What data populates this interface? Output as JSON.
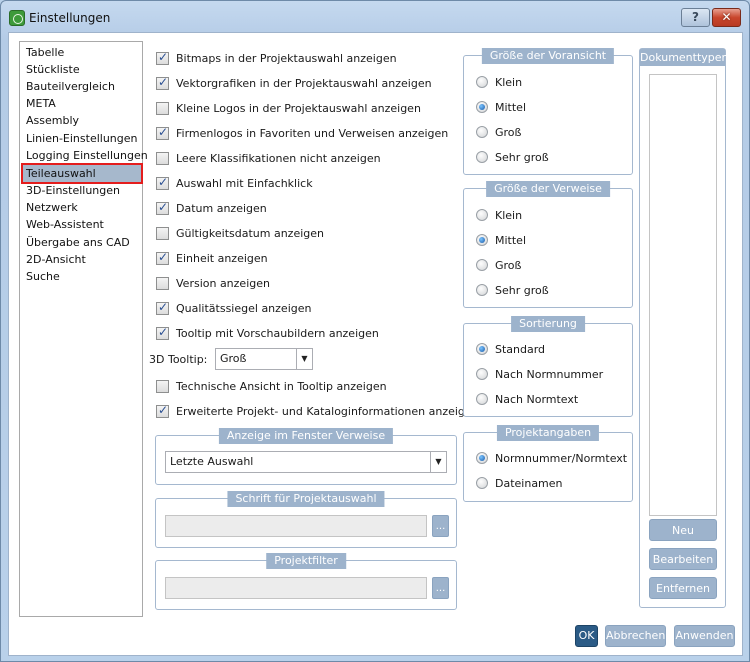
{
  "window": {
    "title": "Einstellungen",
    "help_label": "?",
    "close_label": "✕"
  },
  "nav": {
    "items": [
      {
        "label": "Tabelle"
      },
      {
        "label": "Stückliste"
      },
      {
        "label": "Bauteilvergleich"
      },
      {
        "label": "META"
      },
      {
        "label": "Assembly"
      },
      {
        "label": "Linien-Einstellungen"
      },
      {
        "label": "Logging Einstellungen"
      },
      {
        "label": "Teileauswahl",
        "selected": true
      },
      {
        "label": "3D-Einstellungen"
      },
      {
        "label": "Netzwerk"
      },
      {
        "label": "Web-Assistent"
      },
      {
        "label": "Übergabe ans CAD"
      },
      {
        "label": "2D-Ansicht"
      },
      {
        "label": "Suche"
      }
    ]
  },
  "options": {
    "checkboxes": [
      {
        "label": "Bitmaps in der Projektauswahl anzeigen",
        "checked": true
      },
      {
        "label": "Vektorgrafiken in der Projektauswahl anzeigen",
        "checked": true
      },
      {
        "label": "Kleine Logos in der Projektauswahl anzeigen",
        "checked": false
      },
      {
        "label": "Firmenlogos in Favoriten und Verweisen anzeigen",
        "checked": true
      },
      {
        "label": "Leere Klassifikationen nicht anzeigen",
        "checked": false
      },
      {
        "label": "Auswahl mit Einfachklick",
        "checked": true
      },
      {
        "label": "Datum anzeigen",
        "checked": true
      },
      {
        "label": "Gültigkeitsdatum anzeigen",
        "checked": false
      },
      {
        "label": "Einheit anzeigen",
        "checked": true
      },
      {
        "label": "Version anzeigen",
        "checked": false
      },
      {
        "label": "Qualitätssiegel anzeigen",
        "checked": true
      },
      {
        "label": "Tooltip mit Vorschaubildern anzeigen",
        "checked": true
      }
    ],
    "tooltip_3d": {
      "label": "3D Tooltip:",
      "value": "Groß"
    },
    "checkboxes_after": [
      {
        "label": "Technische Ansicht in Tooltip anzeigen",
        "checked": false
      },
      {
        "label": "Erweiterte Projekt- und Kataloginformationen anzeigen",
        "checked": true
      }
    ]
  },
  "groups": {
    "anzeige_verweise": {
      "title": "Anzeige im Fenster Verweise",
      "value": "Letzte Auswahl"
    },
    "schrift": {
      "title": "Schrift für Projektauswahl",
      "value": "",
      "button": "..."
    },
    "projektfilter": {
      "title": "Projektfilter",
      "value": "",
      "button": "..."
    },
    "voransicht": {
      "title": "Größe der Voransicht",
      "options": [
        {
          "label": "Klein",
          "checked": false
        },
        {
          "label": "Mittel",
          "checked": true
        },
        {
          "label": "Groß",
          "checked": false
        },
        {
          "label": "Sehr groß",
          "checked": false
        }
      ]
    },
    "verweise": {
      "title": "Größe der Verweise",
      "options": [
        {
          "label": "Klein",
          "checked": false
        },
        {
          "label": "Mittel",
          "checked": true
        },
        {
          "label": "Groß",
          "checked": false
        },
        {
          "label": "Sehr groß",
          "checked": false
        }
      ]
    },
    "sortierung": {
      "title": "Sortierung",
      "options": [
        {
          "label": "Standard",
          "checked": true
        },
        {
          "label": "Nach Normnummer",
          "checked": false
        },
        {
          "label": "Nach Normtext",
          "checked": false
        }
      ]
    },
    "projektangaben": {
      "title": "Projektangaben",
      "options": [
        {
          "label": "Normnummer/Normtext",
          "checked": true
        },
        {
          "label": "Dateinamen",
          "checked": false
        }
      ]
    }
  },
  "dokumenttypen": {
    "title": "Dokumenttypen",
    "buttons": {
      "neu": "Neu",
      "bearbeiten": "Bearbeiten",
      "entfernen": "Entfernen"
    }
  },
  "footer": {
    "ok": "OK",
    "cancel": "Abbrechen",
    "apply": "Anwenden"
  }
}
